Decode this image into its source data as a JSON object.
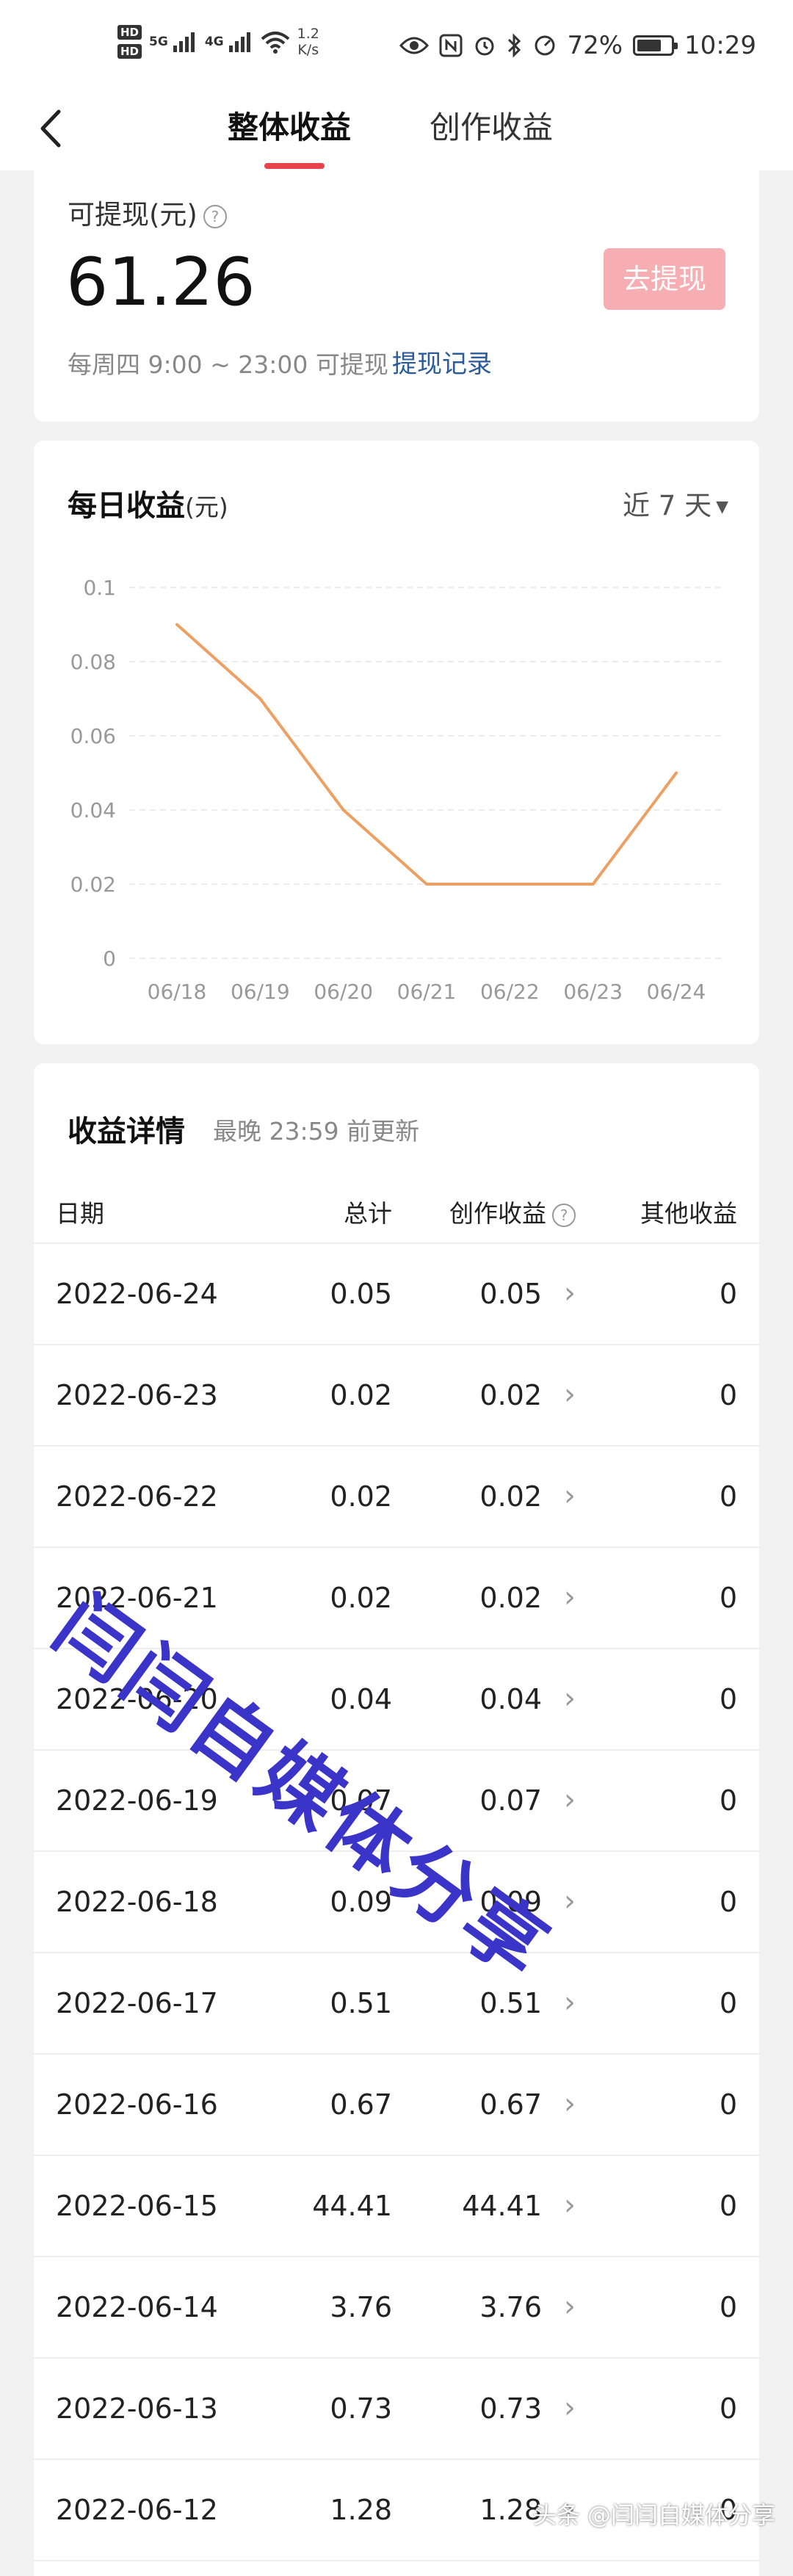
{
  "status_bar": {
    "hd1": "HD",
    "hd2": "HD",
    "signal1": "5G",
    "signal2": "4G",
    "speed_value": "1.2",
    "speed_unit": "K/s",
    "battery": "72%",
    "battery_level": 0.72,
    "time": "10:29"
  },
  "nav": {
    "tabs": [
      {
        "label": "整体收益",
        "active": true
      },
      {
        "label": "创作收益",
        "active": false
      }
    ]
  },
  "withdraw": {
    "label": "可提现(元)",
    "amount": "61.26",
    "button": "去提现",
    "schedule": "每周四 9:00 ~ 23:00 可提现",
    "record_link": "提现记录"
  },
  "daily": {
    "title": "每日收益",
    "unit": "(元)",
    "period": "近 7 天"
  },
  "chart_data": {
    "type": "line",
    "title": "每日收益(元)",
    "x": [
      "06/18",
      "06/19",
      "06/20",
      "06/21",
      "06/22",
      "06/23",
      "06/24"
    ],
    "series": [
      {
        "values": [
          0.09,
          0.07,
          0.04,
          0.02,
          0.02,
          0.02,
          0.05
        ]
      }
    ],
    "ylim": [
      0,
      0.1
    ],
    "yticks": [
      "0",
      "0.02",
      "0.04",
      "0.06",
      "0.08",
      "0.1"
    ],
    "grid": true,
    "line_color": "#eda063"
  },
  "detail": {
    "title": "收益详情",
    "subtitle": "最晚 23:59 前更新",
    "headers": {
      "date": "日期",
      "total": "总计",
      "create": "创作收益",
      "other": "其他收益"
    },
    "rows": [
      {
        "date": "2022-06-24",
        "total": "0.05",
        "create": "0.05",
        "other": "0"
      },
      {
        "date": "2022-06-23",
        "total": "0.02",
        "create": "0.02",
        "other": "0"
      },
      {
        "date": "2022-06-22",
        "total": "0.02",
        "create": "0.02",
        "other": "0"
      },
      {
        "date": "2022-06-21",
        "total": "0.02",
        "create": "0.02",
        "other": "0"
      },
      {
        "date": "2022-06-20",
        "total": "0.04",
        "create": "0.04",
        "other": "0"
      },
      {
        "date": "2022-06-19",
        "total": "0.07",
        "create": "0.07",
        "other": "0"
      },
      {
        "date": "2022-06-18",
        "total": "0.09",
        "create": "0.09",
        "other": "0"
      },
      {
        "date": "2022-06-17",
        "total": "0.51",
        "create": "0.51",
        "other": "0"
      },
      {
        "date": "2022-06-16",
        "total": "0.67",
        "create": "0.67",
        "other": "0"
      },
      {
        "date": "2022-06-15",
        "total": "44.41",
        "create": "44.41",
        "other": "0"
      },
      {
        "date": "2022-06-14",
        "total": "3.76",
        "create": "3.76",
        "other": "0"
      },
      {
        "date": "2022-06-13",
        "total": "0.73",
        "create": "0.73",
        "other": "0"
      },
      {
        "date": "2022-06-12",
        "total": "1.28",
        "create": "1.28",
        "other": "0"
      }
    ]
  },
  "watermarks": {
    "main": "闫闫自媒体分享",
    "footer": "头条 @闫闫自媒体分享"
  }
}
